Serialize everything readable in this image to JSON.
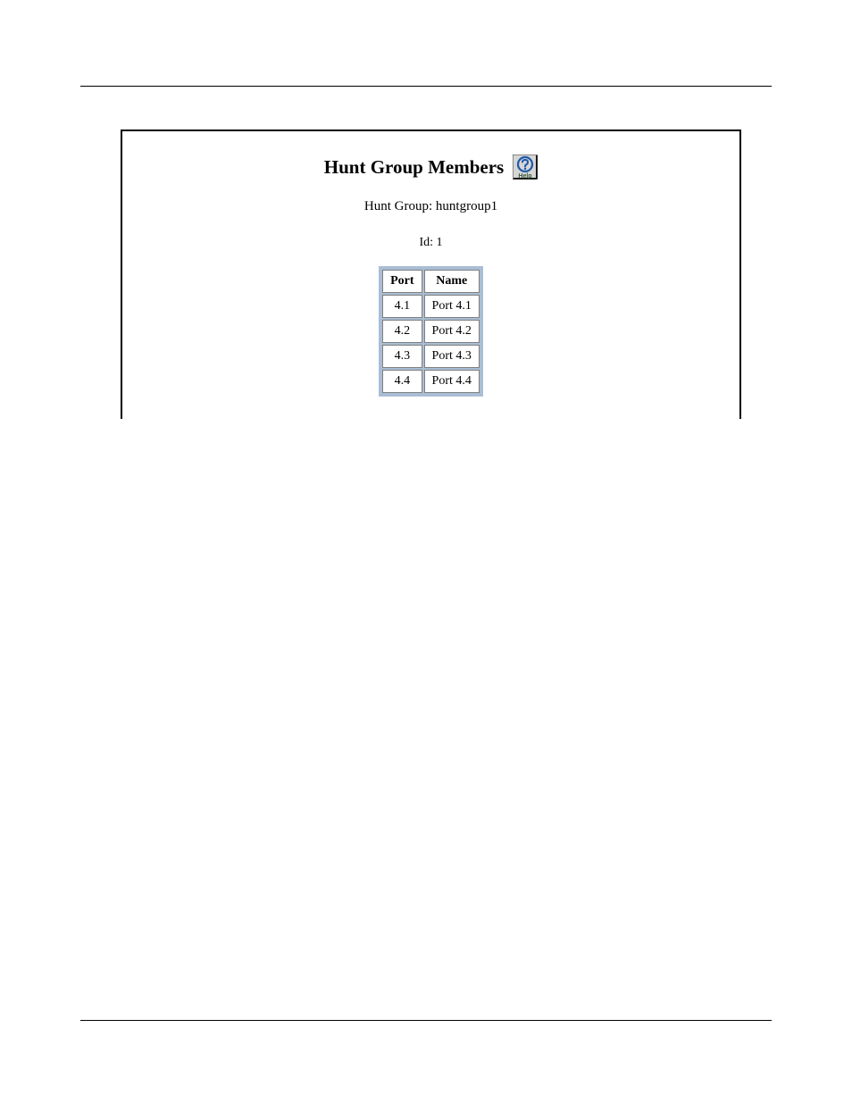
{
  "page": {
    "title": "Hunt Group Members",
    "help_icon": "help-icon",
    "hunt_group_label": "Hunt Group: huntgroup1",
    "id_label": "Id: 1"
  },
  "table": {
    "headers": {
      "port": "Port",
      "name": "Name"
    },
    "rows": [
      {
        "port": "4.1",
        "name": "Port 4.1"
      },
      {
        "port": "4.2",
        "name": "Port 4.2"
      },
      {
        "port": "4.3",
        "name": "Port 4.3"
      },
      {
        "port": "4.4",
        "name": "Port 4.4"
      }
    ]
  }
}
